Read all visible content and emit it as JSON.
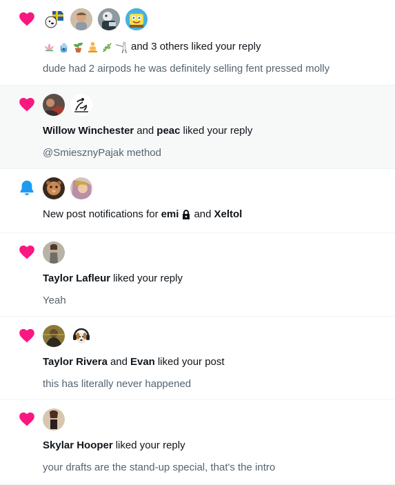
{
  "colors": {
    "heart": "#f91880",
    "bell": "#1d9bf0",
    "muted": "#536471",
    "text": "#0f1419"
  },
  "notifications": [
    {
      "icon": "heart-icon",
      "emoji_names": [
        "lotus-emoji",
        "hamsa-emoji",
        "potted-plant-emoji",
        "meditating-person-emoji",
        "herb-emoji",
        "fencing-emoji"
      ],
      "suffix": "and 3 others liked your reply",
      "snippet": "dude had 2 airpods he was definitely selling fent pressed molly"
    },
    {
      "icon": "heart-icon",
      "user1": "Willow Winchester",
      "joiner": "and",
      "user2": "peac",
      "action": "liked your reply",
      "snippet": "@SmiesznyPajak method"
    },
    {
      "icon": "bell-icon",
      "prefix": "New post notifications for",
      "user1": "emi",
      "joiner": "and",
      "user2": "Xeltol"
    },
    {
      "icon": "heart-icon",
      "user1": "Taylor Lafleur",
      "action": "liked your reply",
      "snippet": "Yeah"
    },
    {
      "icon": "heart-icon",
      "user1": "Taylor Rivera",
      "joiner": "and",
      "user2": "Evan",
      "action": "liked your post",
      "snippet": "this has literally never happened"
    },
    {
      "icon": "heart-icon",
      "user1": "Skylar Hooper",
      "action": "liked your reply",
      "snippet": "your drafts are the stand-up special, that's the intro"
    }
  ]
}
